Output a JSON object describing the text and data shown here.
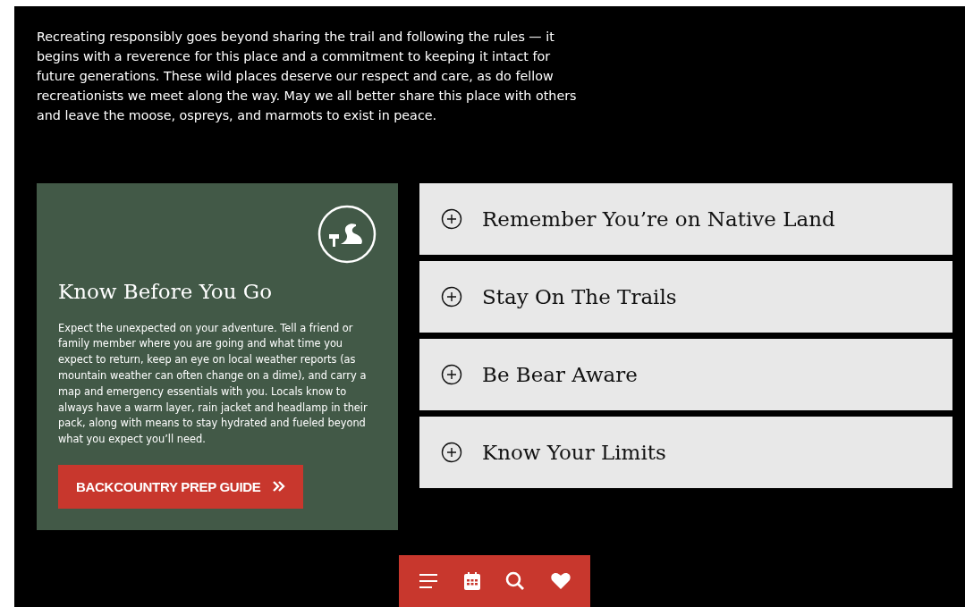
{
  "intro": "Recreating responsibly goes beyond sharing the trail and following the rules — it begins with a reverence for this place and a commitment to keeping it intact for future generations. These wild places deserve our respect and care, as do fellow recreationists we meet along the way. May we all better share this place with others and leave the moose, ospreys, and marmots to exist in peace.",
  "card": {
    "title": "Know Before You Go",
    "body": "Expect the unexpected on your adventure. Tell a friend or family member where you are going and what time you expect to return, keep an eye on local weather reports (as mountain weather can often change on a dime), and carry a map and emergency essentials with you. Locals know to always have a warm layer, rain jacket and headlamp in their pack, along with means to stay hydrated and fueled beyond what you expect you’ll need.",
    "button": "BACKCOUNTRY PREP GUIDE"
  },
  "accordion": [
    {
      "title": "Remember You’re on Native Land",
      "expanded": false
    },
    {
      "title": "Stay On The Trails",
      "expanded": false
    },
    {
      "title": "Be Bear Aware",
      "expanded": false
    },
    {
      "title": "Know Your Limits",
      "expanded": false
    }
  ],
  "nav": [
    {
      "kind": "menu"
    },
    {
      "kind": "calendar"
    },
    {
      "kind": "search"
    },
    {
      "kind": "heart"
    }
  ]
}
